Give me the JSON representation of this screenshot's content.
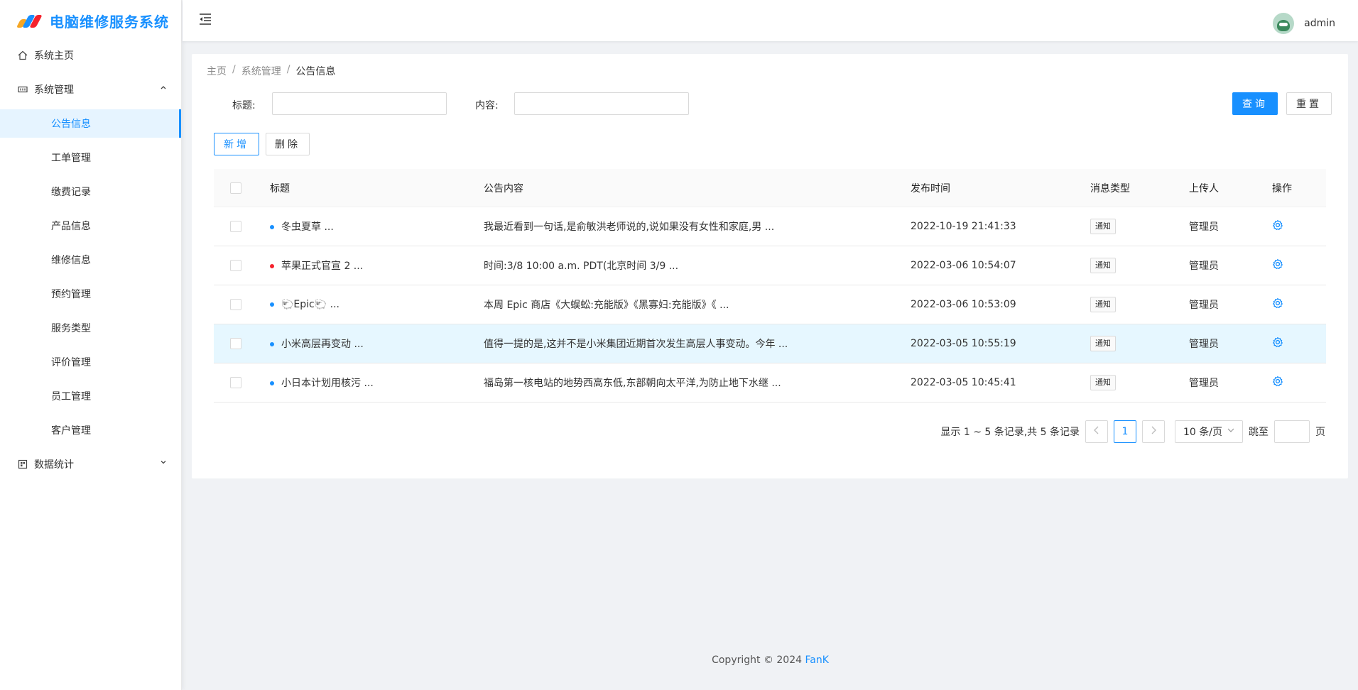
{
  "app": {
    "title": "电脑维修服务系统"
  },
  "sidebar": {
    "items": [
      {
        "label": "系统主页"
      },
      {
        "label": "系统管理"
      },
      {
        "label": "数据统计"
      }
    ],
    "sub_items": [
      {
        "label": "公告信息"
      },
      {
        "label": "工单管理"
      },
      {
        "label": "缴费记录"
      },
      {
        "label": "产品信息"
      },
      {
        "label": "维修信息"
      },
      {
        "label": "预约管理"
      },
      {
        "label": "服务类型"
      },
      {
        "label": "评价管理"
      },
      {
        "label": "员工管理"
      },
      {
        "label": "客户管理"
      }
    ]
  },
  "header": {
    "username": "admin"
  },
  "breadcrumb": {
    "home": "主页",
    "section": "系统管理",
    "current": "公告信息",
    "separator": "/"
  },
  "search": {
    "title_label": "标题:",
    "content_label": "内容:",
    "query_button": "查询",
    "reset_button": "重置"
  },
  "actions": {
    "add_button": "新增",
    "delete_button": "删除"
  },
  "table": {
    "headers": {
      "title": "标题",
      "content": "公告内容",
      "time": "发布时间",
      "type": "消息类型",
      "uploader": "上传人",
      "actions": "操作"
    },
    "rows": [
      {
        "dot_color": "#1890ff",
        "title": "冬虫夏草 ...",
        "content": "我最近看到一句话,是俞敏洪老师说的,说如果没有女性和家庭,男 ...",
        "time": "2022-10-19 21:41:33",
        "type": "通知",
        "uploader": "管理员"
      },
      {
        "dot_color": "#f5222d",
        "title": "苹果正式官宣 2 ...",
        "content": "时间:3/8 10:00 a.m. PDT(北京时间 3/9 ...",
        "time": "2022-03-06 10:54:07",
        "type": "通知",
        "uploader": "管理员"
      },
      {
        "dot_color": "#1890ff",
        "title": "🐑Epic🐑 ...",
        "content": "本周 Epic 商店《大蜈蚣:充能版》《黑寡妇:充能版》《 ...",
        "time": "2022-03-06 10:53:09",
        "type": "通知",
        "uploader": "管理员"
      },
      {
        "dot_color": "#1890ff",
        "title": "小米高层再变动 ...",
        "content": "值得一提的是,这并不是小米集团近期首次发生高层人事变动。今年 ...",
        "time": "2022-03-05 10:55:19",
        "type": "通知",
        "uploader": "管理员"
      },
      {
        "dot_color": "#1890ff",
        "title": "小日本计划用核污 ...",
        "content": "福岛第一核电站的地势西高东低,东部朝向太平洋,为防止地下水继 ...",
        "time": "2022-03-05 10:45:41",
        "type": "通知",
        "uploader": "管理员"
      }
    ]
  },
  "pagination": {
    "summary": "显示 1 ~ 5 条记录,共 5 条记录",
    "current_page": "1",
    "page_size": "10 条/页",
    "jump_prefix": "跳至",
    "jump_suffix": "页"
  },
  "footer": {
    "copyright": "Copyright © 2024",
    "brand": "FanK"
  },
  "colors": {
    "accent": "#1890ff",
    "active_bg": "#e6f4ff",
    "row_hover": "#e6f7ff"
  }
}
